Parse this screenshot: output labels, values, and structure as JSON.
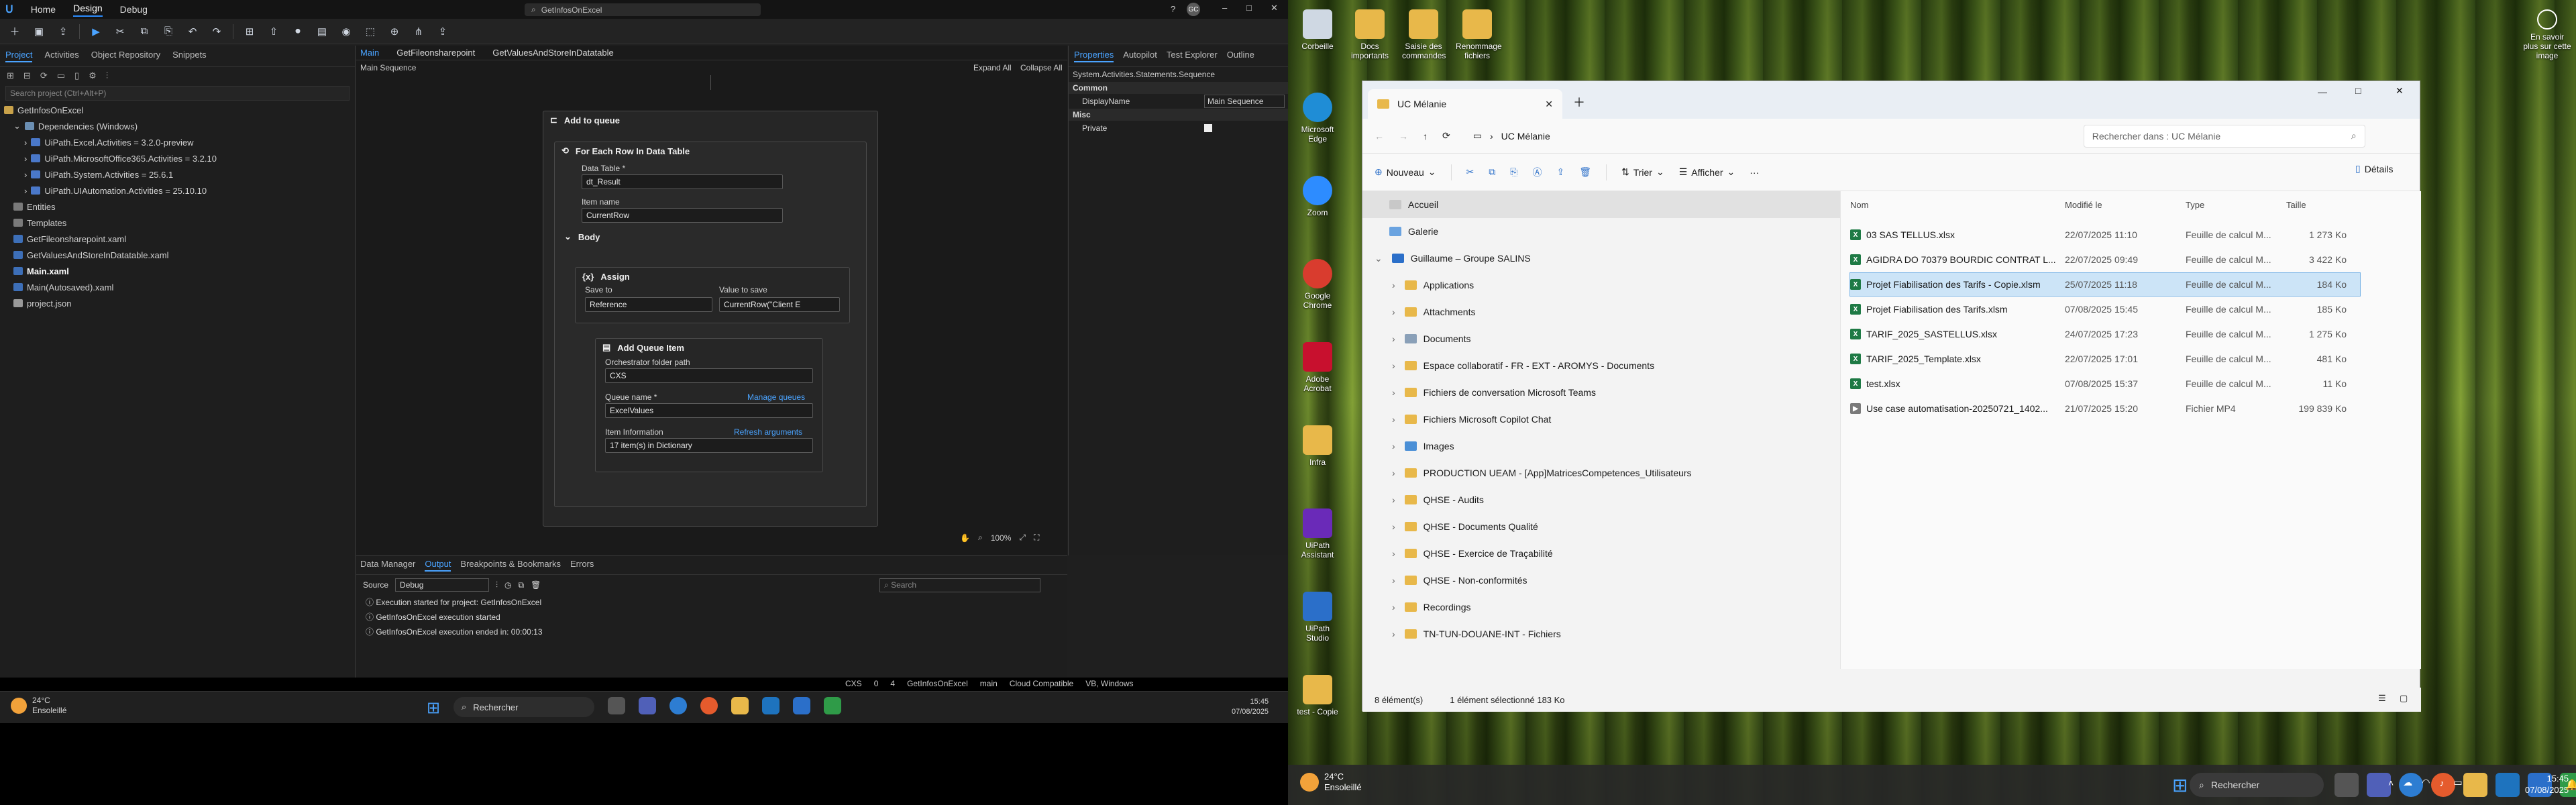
{
  "studio": {
    "menus": [
      "Home",
      "Design",
      "Debug"
    ],
    "active_menu": "Design",
    "search_text": "GetInfosOnExcel",
    "avatar": "GC",
    "left_tabs": [
      "Project",
      "Activities",
      "Object Repository",
      "Snippets"
    ],
    "search_placeholder": "Search project (Ctrl+Alt+P)",
    "project_tree": [
      "GetInfosOnExcel",
      "Dependencies (Windows)",
      "UiPath.Excel.Activities = 3.2.0-preview",
      "UiPath.MicrosoftOffice365.Activities = 3.2.10",
      "UiPath.System.Activities = 25.6.1",
      "UiPath.UIAutomation.Activities = 25.10.10",
      "Entities",
      "Templates",
      "GetFileonsharepoint.xaml",
      "GetValuesAndStoreInDatatable.xaml",
      "Main.xaml",
      "Main(Autosaved).xaml",
      "project.json"
    ],
    "doc_tabs": [
      "Main",
      "GetFileonsharepoint",
      "GetValuesAndStoreInDatatable"
    ],
    "breadcrumb": "Main Sequence",
    "expand_all": "Expand All",
    "collapse_all": "Collapse All",
    "workflow": {
      "add_to_queue": "Add to queue",
      "for_each": "For Each Row In Data Table",
      "data_table_label": "Data Table *",
      "data_table_value": "dt_Result",
      "item_name_label": "Item name",
      "item_name_value": "CurrentRow",
      "body": "Body",
      "assign": "Assign",
      "save_to_label": "Save to",
      "save_to_value": "Reference",
      "value_to_save_label": "Value to save",
      "value_to_save_value": "CurrentRow(\"Client E",
      "add_queue_item": "Add Queue Item",
      "orch_folder_label": "Orchestrator folder path",
      "orch_folder_value": "CXS",
      "queue_name_label": "Queue name *",
      "manage_queues": "Manage queues",
      "queue_name_value": "ExcelValues",
      "item_info_label": "Item Information",
      "refresh_args": "Refresh arguments",
      "item_info_value": "17 item(s) in Dictionary"
    },
    "zoom": "100%",
    "right_tabs": [
      "Properties",
      "Autopilot",
      "Test Explorer",
      "Outline"
    ],
    "prop_header": "System.Activities.Statements.Sequence",
    "prop_common": "Common",
    "prop_display_name_label": "DisplayName",
    "prop_display_name_value": "Main Sequence",
    "prop_misc": "Misc",
    "prop_private_label": "Private",
    "bottom_tabs": [
      "Data Manager",
      "Output",
      "Breakpoints & Bookmarks",
      "Errors"
    ],
    "source_label": "Source",
    "source_value": "Debug",
    "out_search": "Search",
    "output_lines": [
      "Execution started for project: GetInfosOnExcel",
      "GetInfosOnExcel execution started",
      "GetInfosOnExcel execution ended in: 00:00:13"
    ],
    "status_items": [
      "CXS",
      "0",
      "4",
      "GetInfosOnExcel",
      "main",
      "Cloud Compatible",
      "VB, Windows"
    ],
    "weather_temp": "24°C",
    "weather_desc": "Ensoleillé",
    "taskbar_search": "Rechercher",
    "time": "15:45",
    "date": "07/08/2025"
  },
  "desktop": {
    "icons_top": [
      "Corbeille",
      "Docs importants",
      "Saisie des commandes",
      "Renommage fichiers"
    ],
    "icons_left": [
      "Microsoft Edge",
      "Zoom",
      "Google Chrome",
      "Adobe Acrobat",
      "Infra",
      "UiPath Assistant",
      "UiPath Studio",
      "test - Copie"
    ],
    "spotlight": "En savoir plus sur cette image",
    "explorer": {
      "tab_title": "UC Mélanie",
      "address": "UC Mélanie",
      "search_placeholder": "Rechercher dans : UC Mélanie",
      "cmd": {
        "new": "Nouveau",
        "sort": "Trier",
        "view": "Afficher",
        "details": "Détails"
      },
      "nav": [
        {
          "label": "Accueil",
          "type": "home",
          "selected": true
        },
        {
          "label": "Galerie",
          "type": "gallery"
        },
        {
          "label": "Guillaume – Groupe SALINS",
          "type": "cloud"
        },
        {
          "label": "Applications",
          "type": "folder"
        },
        {
          "label": "Attachments",
          "type": "folder"
        },
        {
          "label": "Documents",
          "type": "doc"
        },
        {
          "label": "Espace collaboratif - FR - EXT - AROMYS - Documents",
          "type": "folder"
        },
        {
          "label": "Fichiers de conversation Microsoft Teams",
          "type": "folder"
        },
        {
          "label": "Fichiers Microsoft Copilot Chat",
          "type": "folder"
        },
        {
          "label": "Images",
          "type": "img"
        },
        {
          "label": "PRODUCTION UEAM - [App]MatricesCompetences_Utilisateurs",
          "type": "folder"
        },
        {
          "label": "QHSE - Audits",
          "type": "folder"
        },
        {
          "label": "QHSE - Documents Qualité",
          "type": "folder"
        },
        {
          "label": "QHSE - Exercice de Traçabilité",
          "type": "folder"
        },
        {
          "label": "QHSE - Non-conformités",
          "type": "folder"
        },
        {
          "label": "Recordings",
          "type": "folder"
        },
        {
          "label": "TN-TUN-DOUANE-INT - Fichiers",
          "type": "folder"
        }
      ],
      "columns": [
        "Nom",
        "Modifié le",
        "Type",
        "Taille"
      ],
      "files": [
        {
          "name": "03 SAS TELLUS.xlsx",
          "date": "22/07/2025 11:10",
          "type": "Feuille de calcul M...",
          "size": "1 273 Ko"
        },
        {
          "name": "AGIDRA DO 70379 BOURDIC CONTRAT L...",
          "date": "22/07/2025 09:49",
          "type": "Feuille de calcul M...",
          "size": "3 422 Ko"
        },
        {
          "name": "Projet Fiabilisation des Tarifs - Copie.xlsm",
          "date": "25/07/2025 11:18",
          "type": "Feuille de calcul M...",
          "size": "184 Ko",
          "selected": true
        },
        {
          "name": "Projet Fiabilisation des Tarifs.xlsm",
          "date": "07/08/2025 15:45",
          "type": "Feuille de calcul M...",
          "size": "185 Ko"
        },
        {
          "name": "TARIF_2025_SASTELLUS.xlsx",
          "date": "24/07/2025 17:23",
          "type": "Feuille de calcul M...",
          "size": "1 275 Ko"
        },
        {
          "name": "TARIF_2025_Template.xlsx",
          "date": "22/07/2025 17:01",
          "type": "Feuille de calcul M...",
          "size": "481 Ko"
        },
        {
          "name": "test.xlsx",
          "date": "07/08/2025 15:37",
          "type": "Feuille de calcul M...",
          "size": "11 Ko"
        },
        {
          "name": "Use case automatisation-20250721_1402...",
          "date": "21/07/2025 15:20",
          "type": "Fichier MP4",
          "size": "199 839 Ko"
        }
      ],
      "status_count": "8 élément(s)",
      "status_selected": "1 élément sélectionné  183 Ko"
    },
    "weather_temp": "24°C",
    "weather_desc": "Ensoleillé",
    "taskbar_search": "Rechercher",
    "time": "15:45",
    "date": "07/08/2025"
  }
}
